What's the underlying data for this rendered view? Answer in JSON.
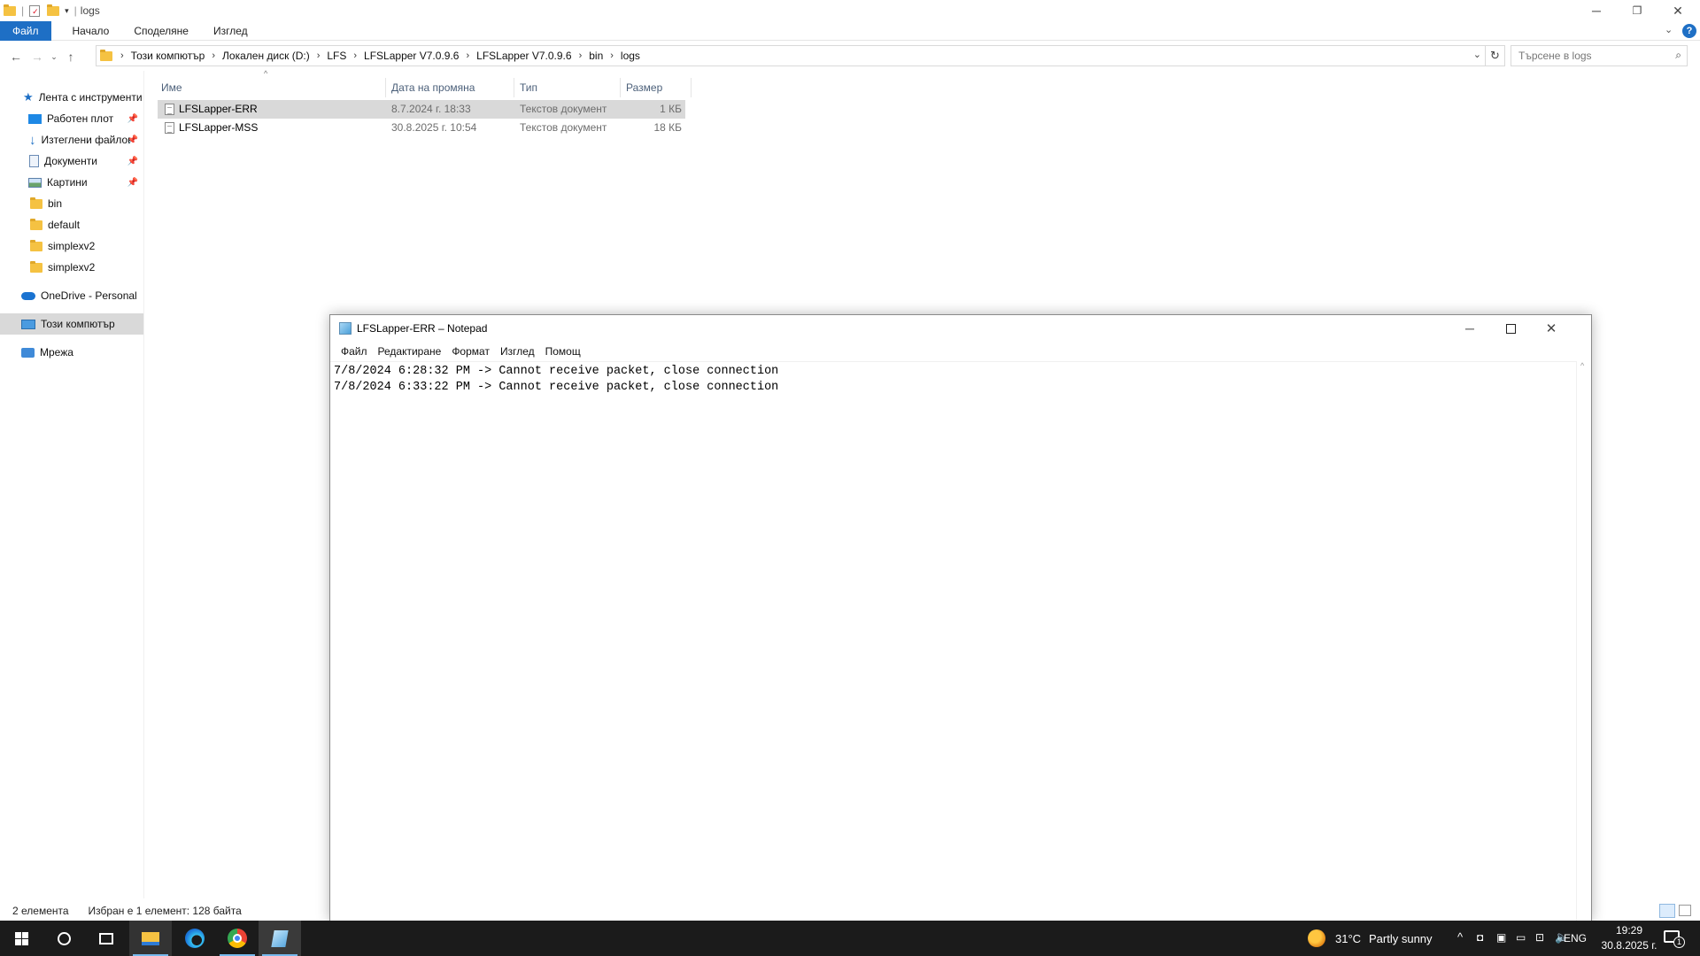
{
  "explorer": {
    "window_title": "logs",
    "ribbon_tabs": [
      "Файл",
      "Начало",
      "Споделяне",
      "Изглед"
    ],
    "breadcrumb": [
      "Този компютър",
      "Локален диск (D:)",
      "LFS",
      "LFSLapper V7.0.9.6",
      "LFSLapper V7.0.9.6",
      "bin",
      "logs"
    ],
    "search_placeholder": "Търсене в logs",
    "nav": {
      "quick_access": "Лента с инструменти",
      "items": [
        {
          "label": "Работен плот",
          "icon": "desktop-icon",
          "pinned": true
        },
        {
          "label": "Изтеглени файлове",
          "icon": "download-icon",
          "pinned": true
        },
        {
          "label": "Документи",
          "icon": "documents-icon",
          "pinned": true
        },
        {
          "label": "Картини",
          "icon": "pictures-icon",
          "pinned": true
        },
        {
          "label": "bin",
          "icon": "folder-icon",
          "pinned": false
        },
        {
          "label": "default",
          "icon": "folder-icon",
          "pinned": false
        },
        {
          "label": "simplexv2",
          "icon": "folder-icon",
          "pinned": false
        },
        {
          "label": "simplexv2",
          "icon": "folder-icon",
          "pinned": false
        }
      ],
      "onedrive": "OneDrive - Personal",
      "this_pc": "Този компютър",
      "network": "Мрежа"
    },
    "columns": {
      "name": "Име",
      "date": "Дата на промяна",
      "type": "Тип",
      "size": "Размер"
    },
    "files": [
      {
        "name": "LFSLapper-ERR",
        "date": "8.7.2024 г. 18:33",
        "type": "Текстов документ",
        "size": "1 КБ",
        "selected": true
      },
      {
        "name": "LFSLapper-MSS",
        "date": "30.8.2025 г. 10:54",
        "type": "Текстов документ",
        "size": "18 КБ",
        "selected": false
      }
    ],
    "status": {
      "count": "2 елемента",
      "selection": "Избран е 1 елемент: 128 байта"
    }
  },
  "notepad": {
    "title": "LFSLapper-ERR – Notepad",
    "menu": [
      "Файл",
      "Редактиране",
      "Формат",
      "Изглед",
      "Помощ"
    ],
    "lines": [
      "7/8/2024 6:28:32 PM -> Cannot receive packet, close connection",
      "7/8/2024 6:33:22 PM -> Cannot receive packet, close connection"
    ]
  },
  "taskbar": {
    "weather": {
      "temp": "31°C",
      "desc": "Partly sunny"
    },
    "lang": "ENG",
    "time": "19:29",
    "date": "30.8.2025 г.",
    "notifications": "1"
  }
}
